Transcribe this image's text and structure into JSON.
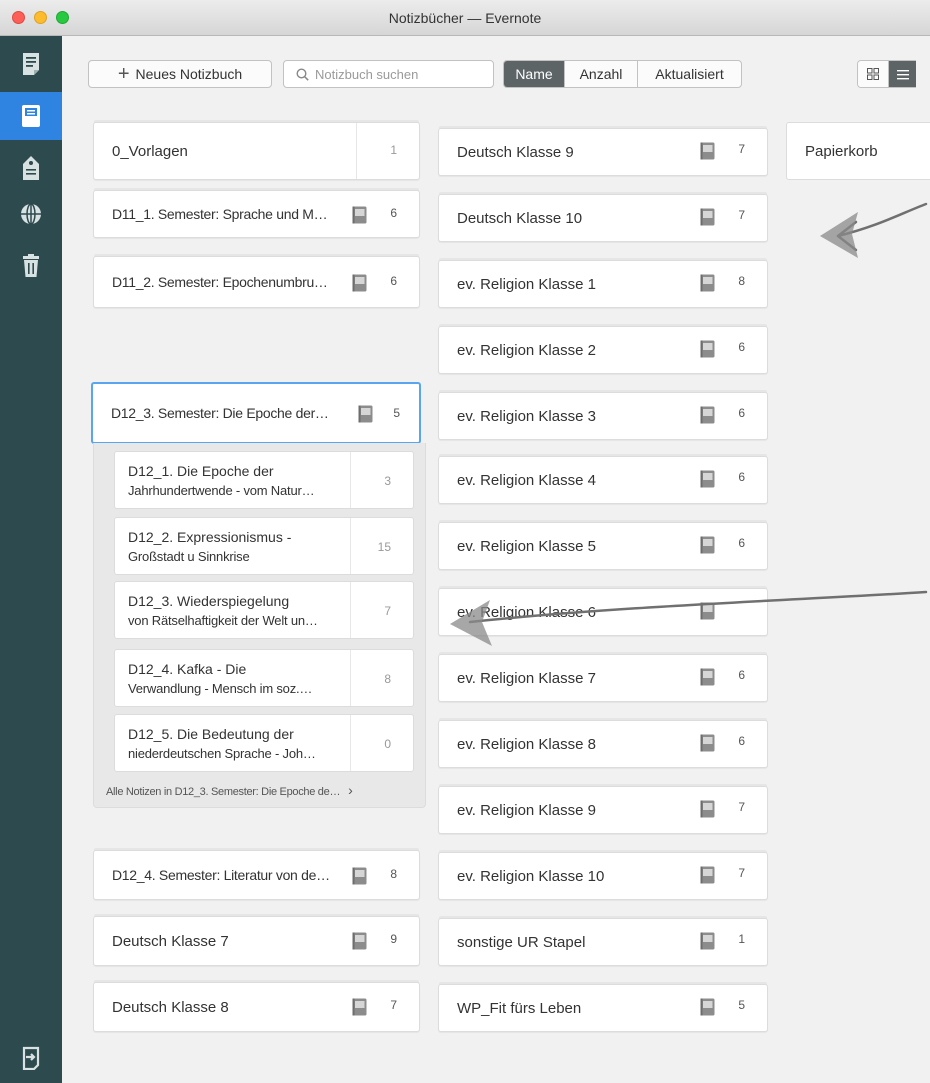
{
  "window": {
    "title": "Notizbücher — Evernote"
  },
  "sidebar": {
    "items": [
      {
        "name": "notes",
        "icon": "note-icon"
      },
      {
        "name": "notebooks",
        "icon": "notebook-icon",
        "active": true
      },
      {
        "name": "tags",
        "icon": "tag-icon"
      },
      {
        "name": "shared",
        "icon": "globe-icon"
      },
      {
        "name": "trash",
        "icon": "trash-icon"
      }
    ],
    "bottom_icon": "sign-out-icon"
  },
  "toolbar": {
    "new_notebook_label": "Neues Notizbuch",
    "search_placeholder": "Notizbuch suchen",
    "sort": {
      "name": "Name",
      "count": "Anzahl",
      "updated": "Aktualisiert",
      "active": "Name"
    },
    "view_modes": [
      "grid",
      "list"
    ],
    "active_view": "list"
  },
  "columns": {
    "col1": [
      {
        "title": "0_Vorlagen",
        "count": "1",
        "shared": false
      },
      {
        "title": "D11_1. Semester: Sprache und M…",
        "count": "6",
        "shared": true
      },
      {
        "title": "D11_2. Semester: Epochenumbru…",
        "count": "6",
        "shared": true
      },
      {
        "title": "D12_3. Semester: Die Epoche der…",
        "count": "5",
        "shared": true,
        "selected": true
      },
      {
        "title": "D12_4. Semester: Literatur von de…",
        "count": "8",
        "shared": true
      },
      {
        "title": "Deutsch Klasse 7",
        "count": "9",
        "shared": true
      },
      {
        "title": "Deutsch Klasse 8",
        "count": "7",
        "shared": true
      }
    ],
    "col2": [
      {
        "title": "Deutsch Klasse 9",
        "count": "7"
      },
      {
        "title": "Deutsch Klasse 10",
        "count": "7"
      },
      {
        "title": "ev. Religion Klasse 1",
        "count": "8"
      },
      {
        "title": "ev. Religion Klasse 2",
        "count": "6"
      },
      {
        "title": "ev. Religion Klasse 3",
        "count": "6"
      },
      {
        "title": "ev. Religion Klasse 4",
        "count": "6"
      },
      {
        "title": "ev. Religion Klasse 5",
        "count": "6"
      },
      {
        "title": "ev. Religion Klasse 6",
        "count": ""
      },
      {
        "title": "ev. Religion Klasse 7",
        "count": "6"
      },
      {
        "title": "ev. Religion Klasse 8",
        "count": "6"
      },
      {
        "title": "ev. Religion Klasse 9",
        "count": "7"
      },
      {
        "title": "ev. Religion Klasse 10",
        "count": "7"
      },
      {
        "title": "sonstige UR Stapel",
        "count": "1"
      },
      {
        "title": "WP_Fit fürs Leben",
        "count": "5"
      }
    ],
    "col3": [
      {
        "title": "Papierkorb"
      }
    ]
  },
  "stack": {
    "notebooks": [
      {
        "line1": "D12_1. Die Epoche der",
        "line2": "Jahrhundertwende - vom Natur…",
        "count": "3"
      },
      {
        "line1": "D12_2. Expressionismus -",
        "line2": "Großstadt u Sinnkrise",
        "count": "15"
      },
      {
        "line1": "D12_3. Wiederspiegelung",
        "line2": "von Rätselhaftigkeit der Welt un…",
        "count": "7"
      },
      {
        "line1": "D12_4. Kafka - Die",
        "line2": "Verwandlung - Mensch im soz.…",
        "count": "8"
      },
      {
        "line1": "D12_5. Die Bedeutung der",
        "line2": "niederdeutschen Sprache - Joh…",
        "count": "0"
      }
    ],
    "all_notes_link": "Alle Notizen in D12_3. Semester: Die Epoche de…"
  },
  "colors": {
    "sidebar_bg": "#2d4a4e",
    "sidebar_active": "#2f83e1",
    "selected_border": "#5aa5f0",
    "annotation": "#707070"
  }
}
